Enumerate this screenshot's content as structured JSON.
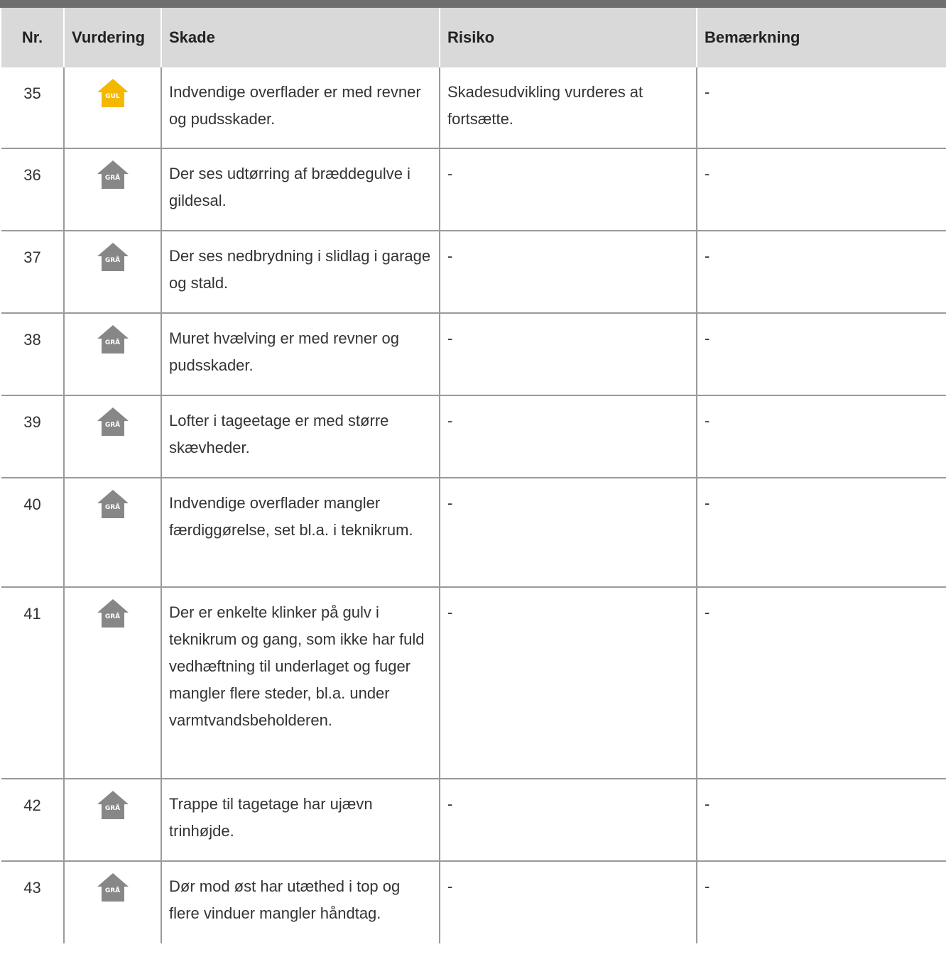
{
  "table": {
    "headers": {
      "nr": "Nr.",
      "vurdering": "Vurdering",
      "skade": "Skade",
      "risiko": "Risiko",
      "bemaerkning": "Bemærkning"
    },
    "rows": [
      {
        "nr": "35",
        "rating": "GUL",
        "rating_color": "#f5b800",
        "skade": "Indvendige overflader er med revner og pudsskader.",
        "risiko": "Skadesudvikling vurderes at fortsætte.",
        "bemaerkning": "-"
      },
      {
        "nr": "36",
        "rating": "GRÅ",
        "rating_color": "#878787",
        "skade": "Der ses udtørring af bræddegulve i gildesal.",
        "risiko": "-",
        "bemaerkning": "-"
      },
      {
        "nr": "37",
        "rating": "GRÅ",
        "rating_color": "#878787",
        "skade": "Der ses nedbrydning i slidlag i garage og stald.",
        "risiko": "-",
        "bemaerkning": "-"
      },
      {
        "nr": "38",
        "rating": "GRÅ",
        "rating_color": "#878787",
        "skade": "Muret hvælving er med revner og pudsskader.",
        "risiko": "-",
        "bemaerkning": "-"
      },
      {
        "nr": "39",
        "rating": "GRÅ",
        "rating_color": "#878787",
        "skade": "Lofter i tageetage er med større skævheder.",
        "risiko": "-",
        "bemaerkning": "-"
      },
      {
        "nr": "40",
        "rating": "GRÅ",
        "rating_color": "#878787",
        "skade": "Indvendige overflader mangler færdiggørelse, set bl.a. i teknikrum.",
        "risiko": "-",
        "bemaerkning": "-"
      },
      {
        "nr": "41",
        "rating": "GRÅ",
        "rating_color": "#878787",
        "skade": "Der er enkelte klinker på gulv i teknikrum og gang, som ikke har fuld vedhæftning til underlaget og fuger mangler flere steder, bl.a. under varmtvandsbeholderen.",
        "risiko": "-",
        "bemaerkning": "-"
      },
      {
        "nr": "42",
        "rating": "GRÅ",
        "rating_color": "#878787",
        "skade": "Trappe til tagetage har ujævn trinhøjde.",
        "risiko": "-",
        "bemaerkning": "-"
      },
      {
        "nr": "43",
        "rating": "GRÅ",
        "rating_color": "#878787",
        "skade": "Dør mod øst har utæthed i top og flere vinduer mangler håndtag.",
        "risiko": "-",
        "bemaerkning": "-"
      }
    ]
  }
}
